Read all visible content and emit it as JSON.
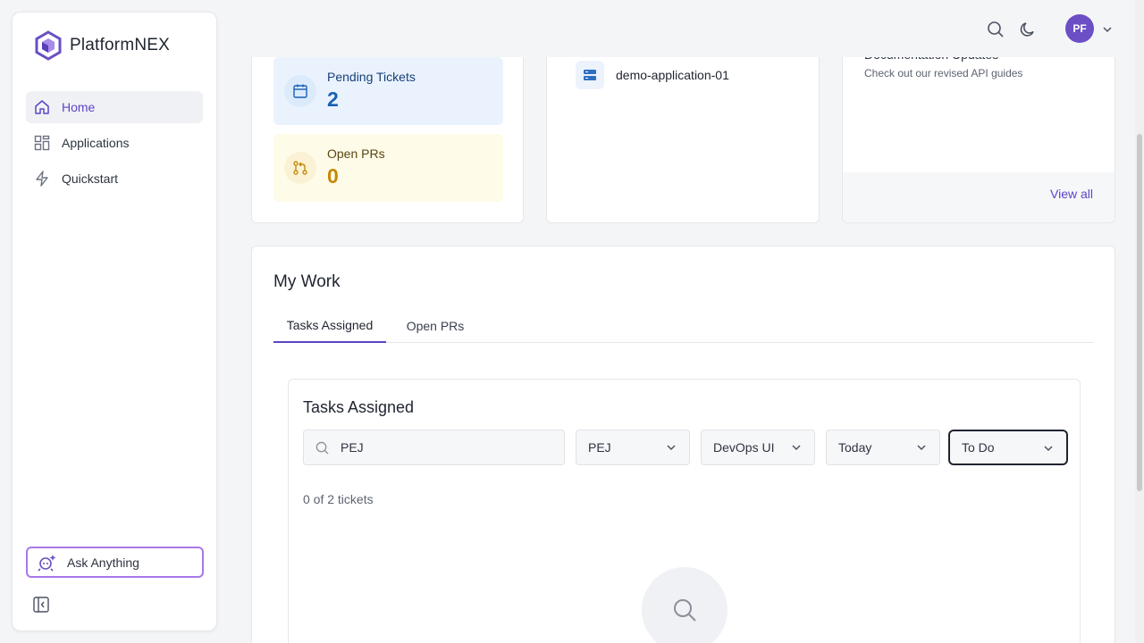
{
  "app": {
    "brand_name": "PlatformNEX"
  },
  "sidebar": {
    "items": [
      {
        "label": "Home",
        "icon": "home-icon",
        "active": true
      },
      {
        "label": "Applications",
        "icon": "grid-icon",
        "active": false
      },
      {
        "label": "Quickstart",
        "icon": "lightning-icon",
        "active": false
      }
    ],
    "ask_label": "Ask Anything"
  },
  "topbar": {
    "avatar_initials": "PF"
  },
  "stats": {
    "pending_label": "Pending Tickets",
    "pending_value": "2",
    "prs_label": "Open PRs",
    "prs_value": "0"
  },
  "applications_card": {
    "app_name": "demo-application-01"
  },
  "docs_card": {
    "title": "Documentation Updates",
    "subtitle": "Check out our revised API guides",
    "view_all": "View all"
  },
  "my_work": {
    "title": "My Work",
    "tabs": [
      "Tasks Assigned",
      "Open PRs"
    ],
    "panel_title": "Tasks Assigned",
    "search_value": "PEJ",
    "filters": [
      "PEJ",
      "DevOps UI",
      "Today",
      "To Do"
    ],
    "count_text": "0 of 2 tickets"
  },
  "colors": {
    "accent": "#5b45c9",
    "avatar": "#6b4fc4",
    "pending_bg": "#eaf3fd",
    "prs_bg": "#fefbe8"
  }
}
